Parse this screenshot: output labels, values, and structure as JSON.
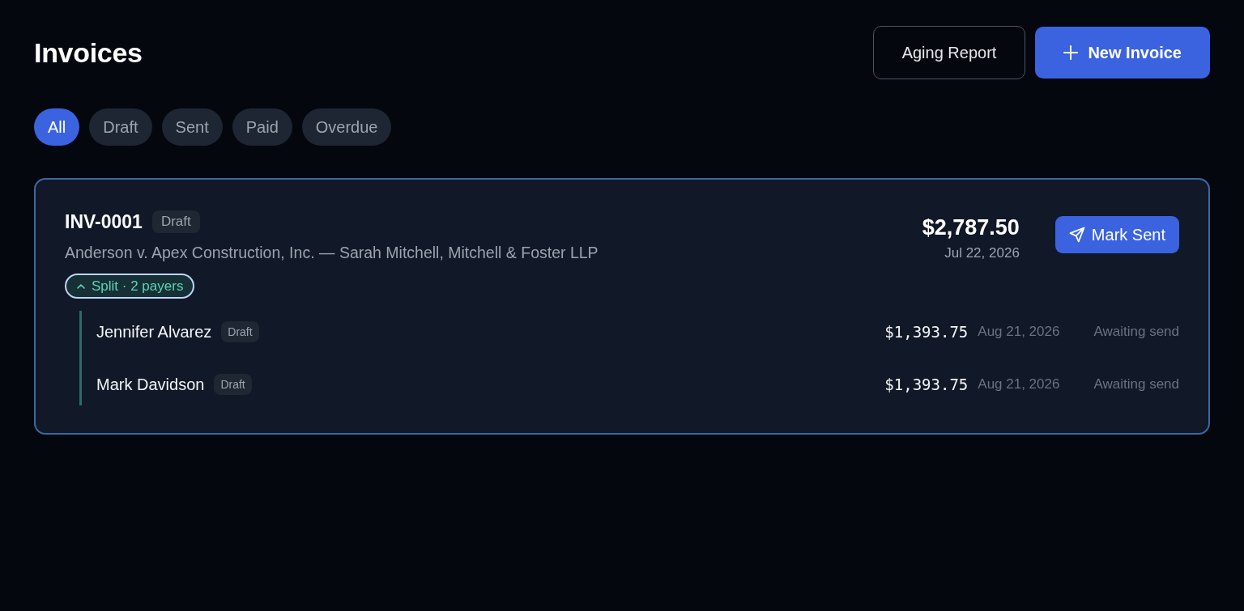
{
  "header": {
    "title": "Invoices",
    "buttons": [
      {
        "label": "Aging Report",
        "kind": "outline"
      },
      {
        "label": "New Invoice",
        "kind": "primary"
      }
    ]
  },
  "filters": [
    {
      "label": "All",
      "selected": true
    },
    {
      "label": "Draft",
      "selected": false
    },
    {
      "label": "Sent",
      "selected": false
    },
    {
      "label": "Paid",
      "selected": false
    },
    {
      "label": "Overdue",
      "selected": false
    }
  ],
  "invoices": [
    {
      "number": "INV-0001",
      "status": "Draft",
      "description": "Anderson v. Apex Construction, Inc. — Sarah Mitchell, Mitchell & Foster LLP",
      "total": "$2,787.50",
      "date": "Jul 22, 2026",
      "action": "Mark Sent",
      "split": {
        "label": "Split · 2 payers",
        "expanded": true,
        "payers": [
          {
            "name": "Jennifer Alvarez",
            "status": "Draft",
            "amount": "$1,393.75",
            "due": "Aug 21, 2026",
            "note": "Awaiting send"
          },
          {
            "name": "Mark Davidson",
            "status": "Draft",
            "amount": "$1,393.75",
            "due": "Aug 21, 2026",
            "note": "Awaiting send"
          }
        ]
      }
    }
  ]
}
